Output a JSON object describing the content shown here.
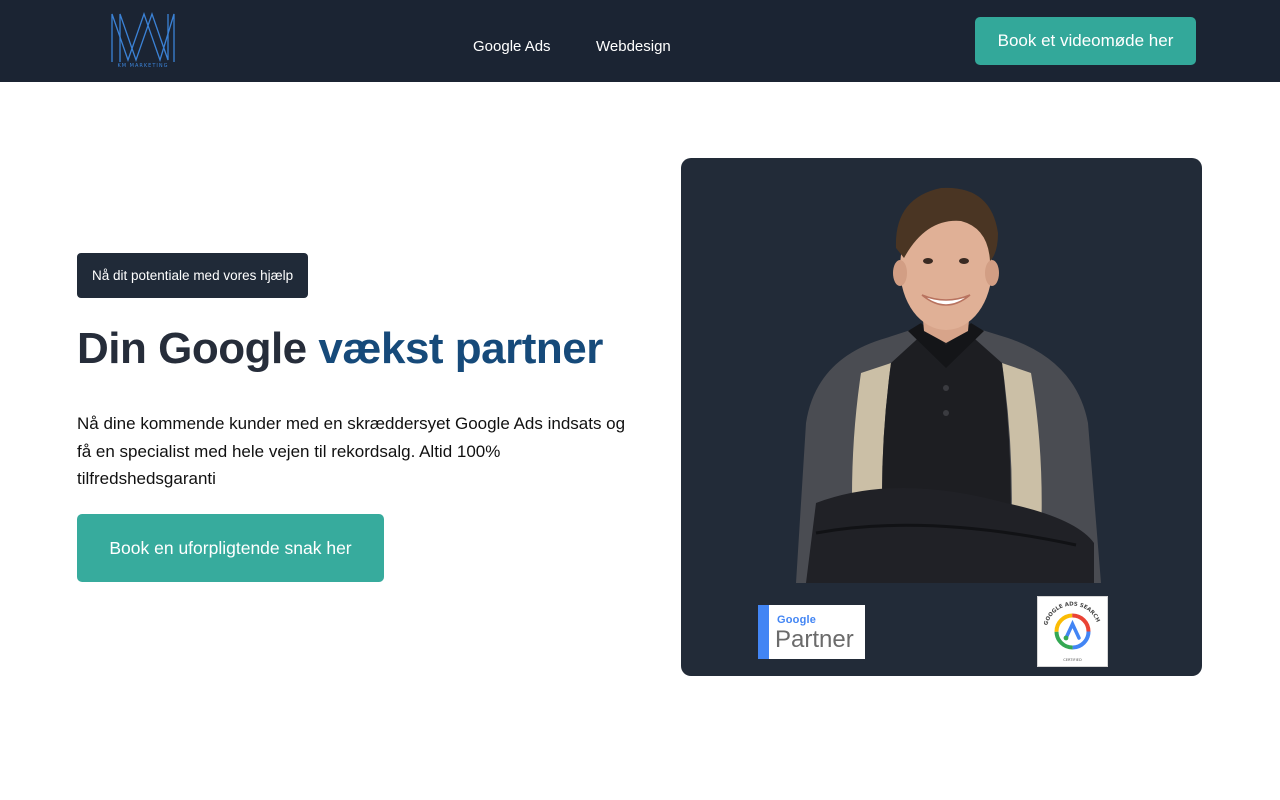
{
  "header": {
    "logo_caption": "KM MARKETING",
    "nav": [
      {
        "label": "Google Ads"
      },
      {
        "label": "Webdesign"
      }
    ],
    "cta_label": "Book et videomøde her"
  },
  "hero": {
    "badge": "Nå dit potentiale med vores hjælp",
    "title_start": "Din Google ",
    "title_accent": "vækst partner",
    "lead": "Nå dine kommende kunder med en skræddersyet Google Ads indsats og få en specialist med hele vejen til rekordsalg. Altid 100% tilfredshedsgaranti",
    "cta_label": "Book en uforpligtende snak her"
  },
  "badges": {
    "partner_google": "Google",
    "partner_word": "Partner",
    "cert_ring_text": "GOOGLE ADS SEARCH",
    "cert_bottom_text": "CERTIFIED"
  },
  "colors": {
    "header_bg": "#1b2433",
    "accent_teal": "#37ab9d",
    "title_accent": "#164a7a",
    "card_bg": "#222b38"
  }
}
